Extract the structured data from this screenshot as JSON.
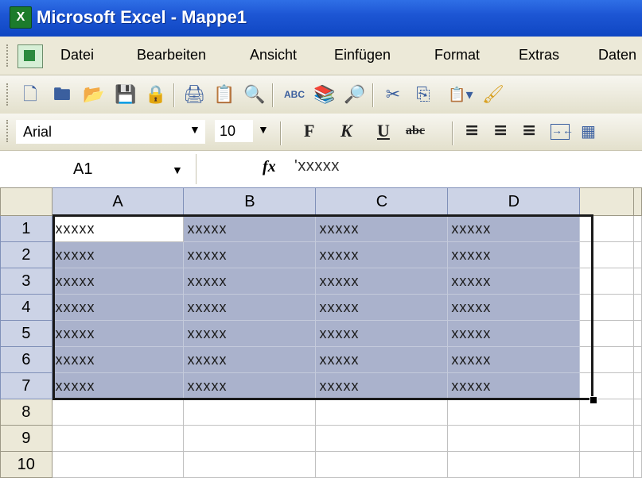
{
  "window": {
    "title": "Microsoft Excel - Mappe1",
    "app_icon": "excel-icon"
  },
  "menu": {
    "items": [
      "Datei",
      "Bearbeiten",
      "Ansicht",
      "Einfügen",
      "Format",
      "Extras",
      "Daten"
    ]
  },
  "toolbar_standard": {
    "icons": [
      "new-icon",
      "open-icon",
      "folder-icon",
      "save-icon",
      "permission-icon",
      "print-icon",
      "print-preview-icon",
      "search-icon",
      "spelling-icon",
      "research-icon",
      "track-icon",
      "cut-icon",
      "copy-icon",
      "paste-icon",
      "format-painter-icon"
    ],
    "glyphs": [
      "🗋",
      "🖿",
      "📂",
      "💾",
      "🔒",
      "🖨",
      "📋",
      "🔍",
      "ABC",
      "📚",
      "🔎",
      "✂",
      "⎘",
      "📋▾",
      "🖌"
    ]
  },
  "toolbar_format": {
    "font": "Arial",
    "size": "10",
    "bold_label": "F",
    "italic_label": "K",
    "underline_label": "U",
    "strike_label": "abc"
  },
  "formula_bar": {
    "name_box": "A1",
    "fx_label": "fx",
    "content": "'xxxxx"
  },
  "sheet": {
    "columns": [
      "A",
      "B",
      "C",
      "D",
      "",
      ""
    ],
    "rows": [
      {
        "num": "1",
        "cells": [
          "xxxxx",
          "xxxxx",
          "xxxxx",
          "xxxxx",
          "",
          ""
        ]
      },
      {
        "num": "2",
        "cells": [
          "xxxxx",
          "xxxxx",
          "xxxxx",
          "xxxxx",
          "",
          ""
        ]
      },
      {
        "num": "3",
        "cells": [
          "xxxxx",
          "xxxxx",
          "xxxxx",
          "xxxxx",
          "",
          ""
        ]
      },
      {
        "num": "4",
        "cells": [
          "xxxxx",
          "xxxxx",
          "xxxxx",
          "xxxxx",
          "",
          ""
        ]
      },
      {
        "num": "5",
        "cells": [
          "xxxxx",
          "xxxxx",
          "xxxxx",
          "xxxxx",
          "",
          ""
        ]
      },
      {
        "num": "6",
        "cells": [
          "xxxxx",
          "xxxxx",
          "xxxxx",
          "xxxxx",
          "",
          ""
        ]
      },
      {
        "num": "7",
        "cells": [
          "xxxxx",
          "xxxxx",
          "xxxxx",
          "xxxxx",
          "",
          ""
        ]
      },
      {
        "num": "8",
        "cells": [
          "",
          "",
          "",
          "",
          "",
          ""
        ]
      },
      {
        "num": "9",
        "cells": [
          "",
          "",
          "",
          "",
          "",
          ""
        ]
      },
      {
        "num": "10",
        "cells": [
          "",
          "",
          "",
          "",
          "",
          ""
        ]
      }
    ],
    "selection": "A1:D7",
    "active_cell": "A1"
  },
  "colors": {
    "title_bar": "#1d56d4",
    "selection": "#aab2cc",
    "header_selected": "#ccd3e6",
    "chrome": "#ece9d8"
  }
}
